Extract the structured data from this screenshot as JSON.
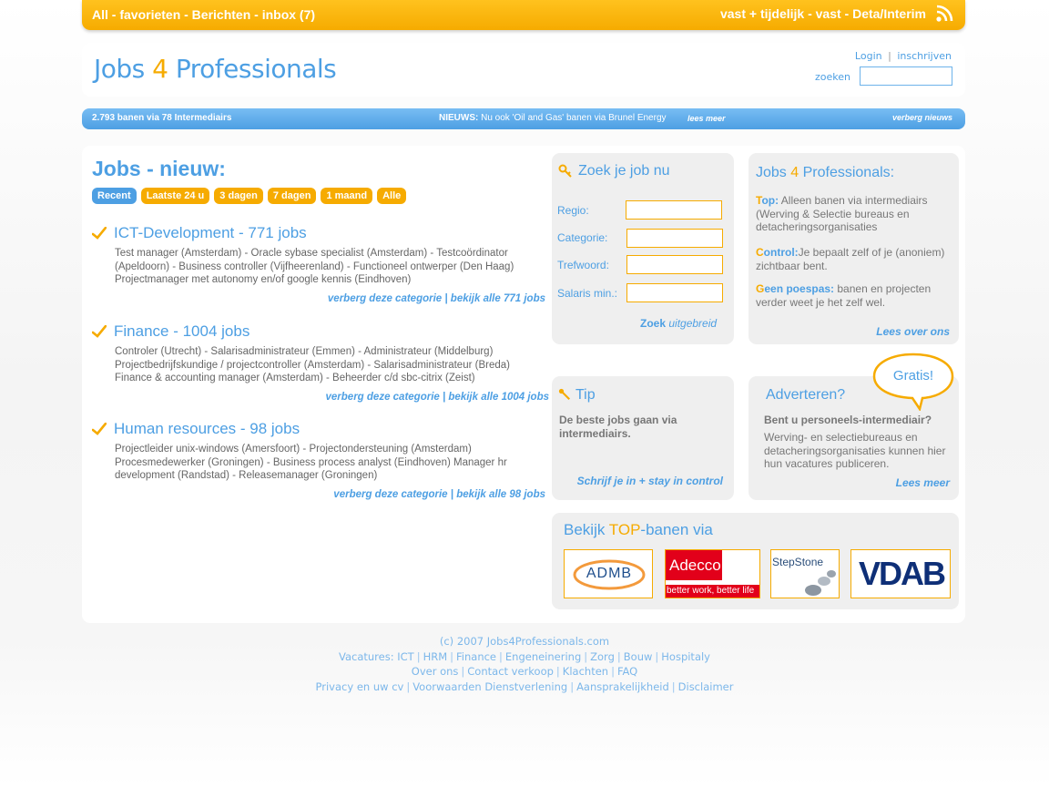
{
  "topnav": {
    "left": "All - favorieten - Berichten - inbox (7)",
    "right": "vast + tijdelijk - vast - Deta/Interim",
    "rss_icon": "rss-icon"
  },
  "header": {
    "logo_part1": "Jobs ",
    "logo_four": "4",
    "logo_part2": " Professionals",
    "login": "Login",
    "register": "inschrijven",
    "search_label": "zoeken"
  },
  "newsbar": {
    "count": "2.793 banen via 78 Intermediairs",
    "news_label": "NIEUWS:",
    "news_text": " Nu ook 'Oil and Gas' banen via Brunel Energy",
    "more": "lees meer",
    "hide": "verberg nieuws"
  },
  "jobs": {
    "title": "Jobs - nieuw:",
    "filters": [
      "Recent",
      "Laatste 24 u",
      "3 dagen",
      "7 dagen",
      "1 maand",
      "Alle"
    ],
    "categories": [
      {
        "title": "ICT-Development - 771 jobs",
        "jobs": "Test manager (Amsterdam) - Oracle sybase specialist (Amsterdam) - Testcoördinator (Apeldoorn) - Business controller (Vijfheerenland) - Functioneel ontwerper (Den Haag) Projectmanager met autonomy en/of google kennis (Eindhoven)",
        "hide": "verberg deze categorie",
        "all": "bekijk alle 771 jobs"
      },
      {
        "title": "Finance - 1004 jobs",
        "jobs": "Controler (Utrecht) - Salarisadministrateur (Emmen) - Administrateur (Middelburg) Projectbedrijfskundige / projectcontroller (Amsterdam) - Salarisadministrateur (Breda) Finance & accounting manager (Amsterdam) - Beheerder c/d sbc-citrix (Zeist)",
        "hide": "verberg deze categorie",
        "all": "bekijk alle 1004 jobs"
      },
      {
        "title": "Human resources - 98 jobs",
        "jobs": "Projectleider unix-windows (Amersfoort) - Projectondersteuning (Amsterdam) Procesmedewerker (Groningen) - Business process analyst (Eindhoven) Manager hr development (Randstad) - Releasemanager (Groningen)",
        "hide": "verberg deze categorie",
        "all": "bekijk alle 98 jobs"
      }
    ],
    "separator": " | "
  },
  "search_box": {
    "title": "Zoek je job nu",
    "labels": [
      "Regio:",
      "Categorie:",
      "Trefwoord:",
      "Salaris min.:"
    ],
    "submit": "Zoek",
    "advanced": "uitgebreid"
  },
  "about_box": {
    "title_part1": "Jobs ",
    "title_four": "4",
    "title_part2": " Professionals:",
    "items": [
      {
        "first": "T",
        "rest": "op:",
        "text": " Alleen banen via intermediairs (Werving & Selectie bureaus en detacheringsorganisaties"
      },
      {
        "first": "C",
        "rest": "ontrol:",
        "text": "Je bepaalt zelf of je (anoniem) zichtbaar bent."
      },
      {
        "first": "G",
        "rest": "een poespas:",
        "text": " banen en projecten verder weet je het zelf wel."
      }
    ],
    "more": "Lees over ons"
  },
  "tip_box": {
    "title": "Tip",
    "text": "De beste jobs gaan via intermediairs.",
    "link": "Schrijf je in + stay in control"
  },
  "advertise_box": {
    "title": "Adverteren?",
    "question": "Bent u personeels-intermediair?",
    "text": "Werving- en selectiebureaus en detacheringsorganisaties kunnen hier hun vacatures publiceren.",
    "more": "Lees meer",
    "balloon": "Gratis!"
  },
  "top_box": {
    "title_part1": "Bekijk ",
    "title_top": "TOP",
    "title_part2": "-banen via",
    "logos": {
      "admb": "ADMB",
      "adecco": "Adecco",
      "adecco_tagline": "better work, better life",
      "stepstone": "StepStone",
      "vdab": "VDAB"
    }
  },
  "footer": {
    "copyright": "(c) 2007 Jobs4Professionals.com",
    "vacatures_label": "Vacatures:",
    "vacatures": [
      "ICT",
      "HRM",
      "Finance",
      "Engeneinering",
      "Zorg",
      "Bouw",
      "Hospitaly"
    ],
    "line3": [
      "Over ons",
      "Contact verkoop",
      "Klachten",
      "FAQ"
    ],
    "line4": [
      "Privacy en uw cv",
      "Voorwaarden Dienstverlening",
      "Aansprakelijkheid",
      "Disclaimer"
    ]
  },
  "colors": {
    "orange": "#f6ab00",
    "blue": "#4d9fe3",
    "panel_grey": "#efefef"
  }
}
